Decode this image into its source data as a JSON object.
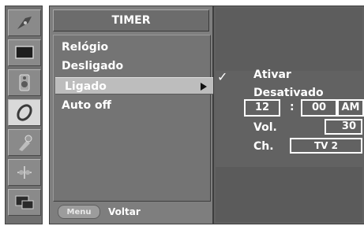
{
  "menu": {
    "title": "TIMER",
    "items": [
      {
        "label": "Relógio"
      },
      {
        "label": "Desligado"
      },
      {
        "label": "Ligado"
      },
      {
        "label": "Auto off"
      }
    ],
    "footer": {
      "button_label": "Menu",
      "label": "Voltar"
    }
  },
  "icons": [
    "signal-icon",
    "picture-icon",
    "audio-icon",
    "timer-icon",
    "setup-icon",
    "option-icon",
    "pip-icon"
  ],
  "submenu": {
    "options": [
      {
        "label": "Ativar"
      },
      {
        "label": "Desativado"
      }
    ],
    "time": {
      "hour": "12",
      "separator": ":",
      "minute": "00",
      "ampm": "AM"
    },
    "volume": {
      "label": "Vol.",
      "value": "30"
    },
    "channel": {
      "label": "Ch.",
      "value": "TV 2"
    }
  }
}
